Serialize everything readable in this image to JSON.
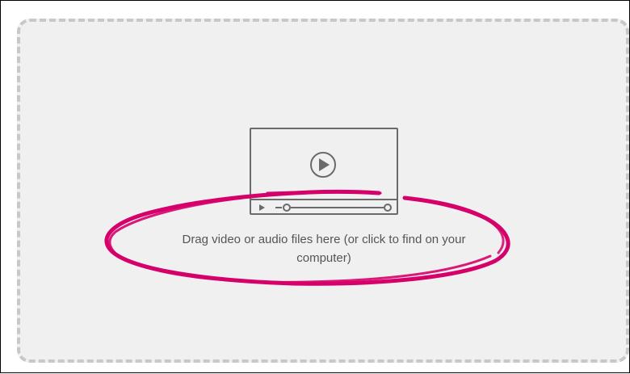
{
  "dropzone": {
    "label": "Drag video or audio files here (or click to find on your computer)",
    "icon": "video-player-icon",
    "play_icon": "play-icon"
  },
  "annotation": {
    "type": "hand-drawn-ellipse",
    "color": "#d6006b"
  },
  "colors": {
    "dropzone_background": "#f0f0f0",
    "dropzone_border": "#c8c8c8",
    "icon_stroke": "#6a6a6a",
    "text": "#555555"
  }
}
